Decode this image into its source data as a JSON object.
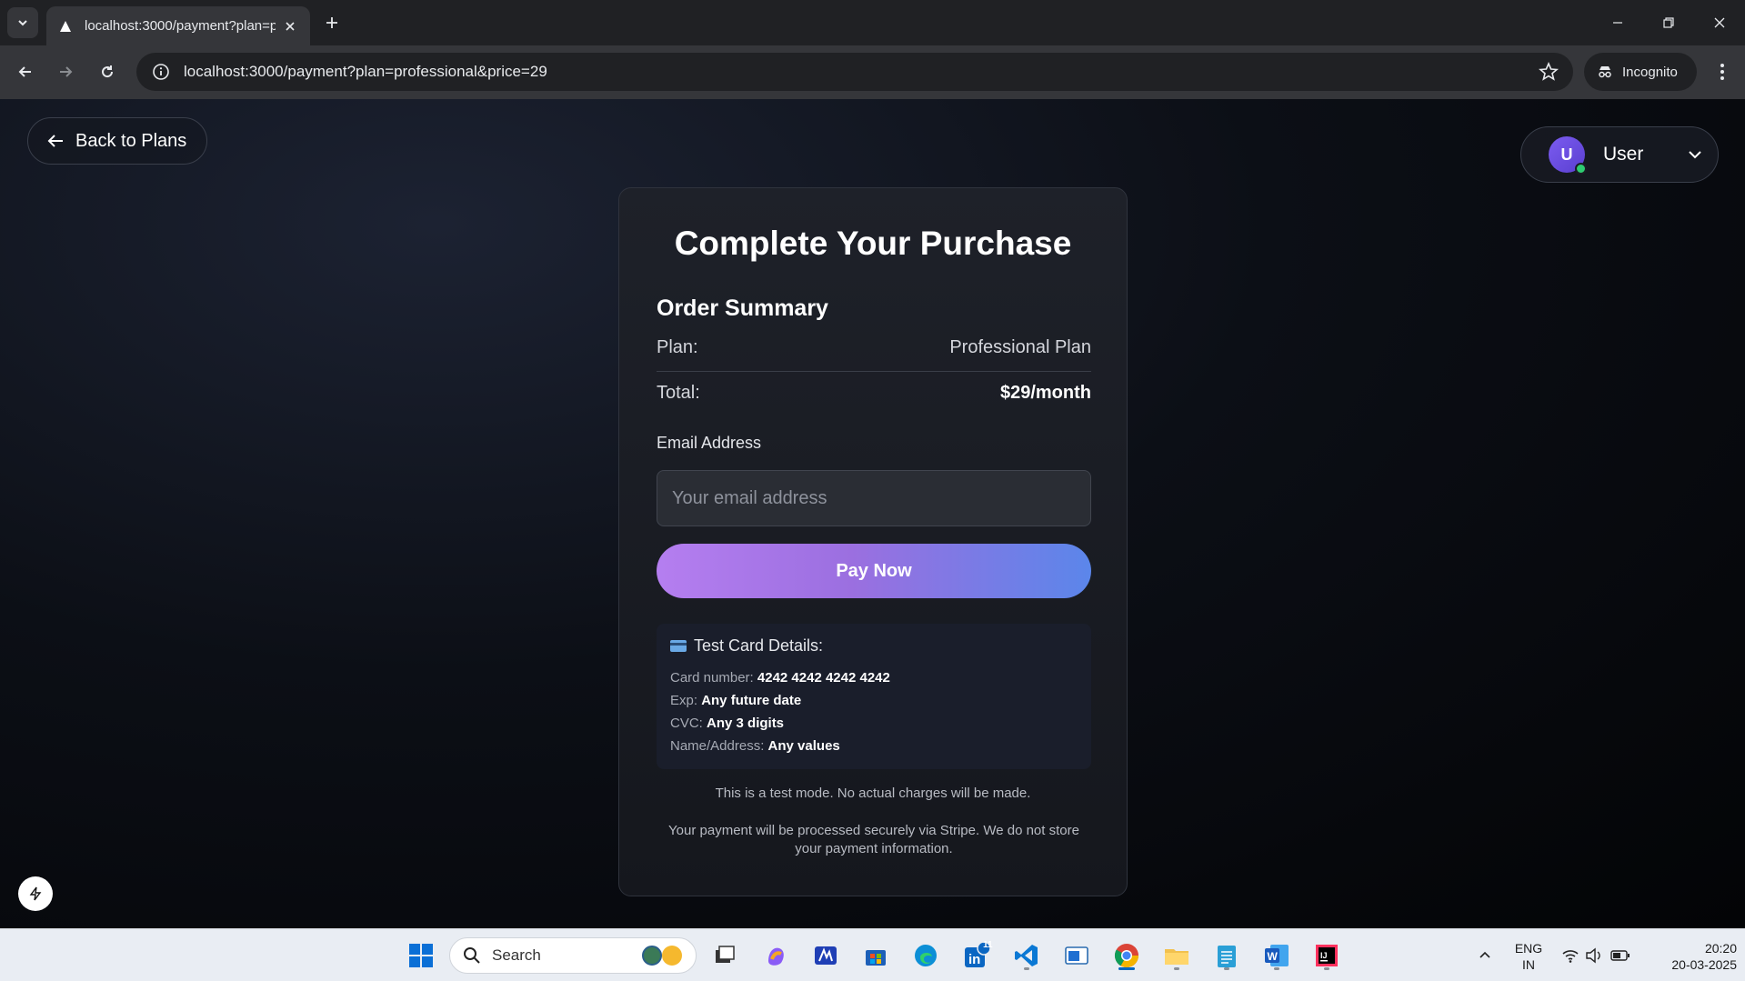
{
  "browser": {
    "tab_title": "localhost:3000/payment?plan=p",
    "url": "localhost:3000/payment?plan=professional&price=29",
    "incognito_label": "Incognito"
  },
  "page": {
    "back_label": "Back to Plans",
    "user": {
      "initial": "U",
      "name": "User"
    },
    "checkout": {
      "title": "Complete Your Purchase",
      "summary_title": "Order Summary",
      "plan_label": "Plan:",
      "plan_value": "Professional Plan",
      "total_label": "Total:",
      "total_value": "$29/month",
      "email_label": "Email Address",
      "email_placeholder": "Your email address",
      "pay_label": "Pay Now",
      "test_card": {
        "title": "Test Card Details:",
        "lines": [
          {
            "label": "Card number:",
            "value": "4242 4242 4242 4242"
          },
          {
            "label": "Exp:",
            "value": "Any future date"
          },
          {
            "label": "CVC:",
            "value": "Any 3 digits"
          },
          {
            "label": "Name/Address:",
            "value": "Any values"
          }
        ]
      },
      "test_note": "This is a test mode. No actual charges will be made.",
      "secure_note": "Your payment will be processed securely via Stripe. We do not store your payment information."
    }
  },
  "taskbar": {
    "search_placeholder": "Search",
    "linkedin_badge": "11",
    "lang_line1": "ENG",
    "lang_line2": "IN",
    "time": "20:20",
    "date": "20-03-2025"
  },
  "colors": {
    "accent_start": "#b57ef0",
    "accent_end": "#5b86ea",
    "online": "#2ecc71"
  }
}
